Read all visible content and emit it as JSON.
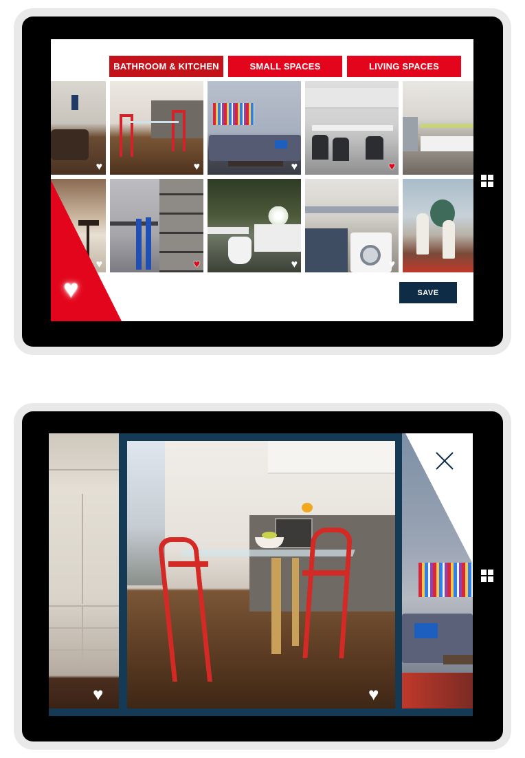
{
  "screen1": {
    "tabs": [
      "BATHROOM & KITCHEN",
      "SMALL SPACES",
      "LIVING SPACES"
    ],
    "save_label": "SAVE",
    "heart_glyph": "♥",
    "tiles": [
      {
        "name": "living-room-tile",
        "fav": false
      },
      {
        "name": "kitchen-dining-tile",
        "fav": false
      },
      {
        "name": "sofa-art-tile",
        "fav": false
      },
      {
        "name": "kitchen-island-tile",
        "fav": true
      },
      {
        "name": "modern-kitchen-tile",
        "fav": false
      },
      {
        "name": "bar-stool-tile",
        "fav": false
      },
      {
        "name": "study-desk-tile",
        "fav": true
      },
      {
        "name": "bathroom-tile",
        "fav": false
      },
      {
        "name": "laundry-tile",
        "fav": false
      },
      {
        "name": "dining-room-tile",
        "fav": false
      }
    ]
  },
  "screen2": {
    "heart_glyph": "♥"
  },
  "colors": {
    "tab_active": "#c4121a",
    "tab": "#e3051b",
    "save_button": "#0e2c46",
    "viewer_border": "#143a55"
  }
}
